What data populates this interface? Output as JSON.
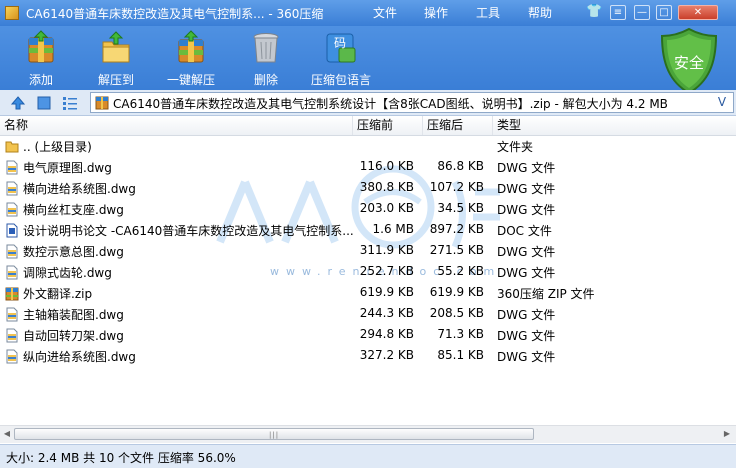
{
  "window": {
    "title": "CA6140普通车床数控改造及其电气控制系... - 360压缩"
  },
  "menu": {
    "file": "文件",
    "operate": "操作",
    "tools": "工具",
    "help": "帮助"
  },
  "window_controls": {
    "skin": "👕",
    "menu": "≡",
    "minimize": "—",
    "maximize": "□",
    "close": "✕"
  },
  "toolbar": {
    "add": "添加",
    "extract_to": "解压到",
    "one_click_extract": "一键解压",
    "delete": "删除",
    "language": "压缩包语言",
    "security": "安全",
    "language_badge": "码"
  },
  "address": {
    "path": "CA6140普通车床数控改造及其电气控制系统设计【含8张CAD图纸、说明书】.zip - 解包大小为 4.2 MB",
    "dropdown": "V"
  },
  "columns": {
    "name": "名称",
    "compressed_before": "压缩前",
    "compressed_after": "压缩后",
    "type": "类型"
  },
  "files": [
    {
      "name": ".. (上级目录)",
      "before": "",
      "after": "",
      "type": "文件夹",
      "icon": "folder-icon"
    },
    {
      "name": "电气原理图.dwg",
      "before": "116.0 KB",
      "after": "86.8 KB",
      "type": "DWG 文件",
      "icon": "dwg-file-icon"
    },
    {
      "name": "横向进给系统图.dwg",
      "before": "380.8 KB",
      "after": "107.2 KB",
      "type": "DWG 文件",
      "icon": "dwg-file-icon"
    },
    {
      "name": "横向丝杠支座.dwg",
      "before": "203.0 KB",
      "after": "34.5 KB",
      "type": "DWG 文件",
      "icon": "dwg-file-icon"
    },
    {
      "name": "设计说明书论文 -CA6140普通车床数控改造及其电气控制系...",
      "before": "1.6 MB",
      "after": "897.2 KB",
      "type": "DOC 文件",
      "icon": "doc-file-icon"
    },
    {
      "name": "数控示意总图.dwg",
      "before": "311.9 KB",
      "after": "271.5 KB",
      "type": "DWG 文件",
      "icon": "dwg-file-icon"
    },
    {
      "name": "调隙式齿轮.dwg",
      "before": "252.7 KB",
      "after": "55.2 KB",
      "type": "DWG 文件",
      "icon": "dwg-file-icon"
    },
    {
      "name": "外文翻译.zip",
      "before": "619.9 KB",
      "after": "619.9 KB",
      "type": "360压缩 ZIP 文件",
      "icon": "zip-file-icon"
    },
    {
      "name": "主轴箱装配图.dwg",
      "before": "244.3 KB",
      "after": "208.5 KB",
      "type": "DWG 文件",
      "icon": "dwg-file-icon"
    },
    {
      "name": "自动回转刀架.dwg",
      "before": "294.8 KB",
      "after": "71.3 KB",
      "type": "DWG 文件",
      "icon": "dwg-file-icon"
    },
    {
      "name": "纵向进给系统图.dwg",
      "before": "327.2 KB",
      "after": "85.1 KB",
      "type": "DWG 文件",
      "icon": "dwg-file-icon"
    }
  ],
  "watermark": {
    "url": "www.renrendoc.com"
  },
  "status": {
    "text": "大小: 2.4 MB 共 10 个文件 压缩率 56.0%"
  }
}
